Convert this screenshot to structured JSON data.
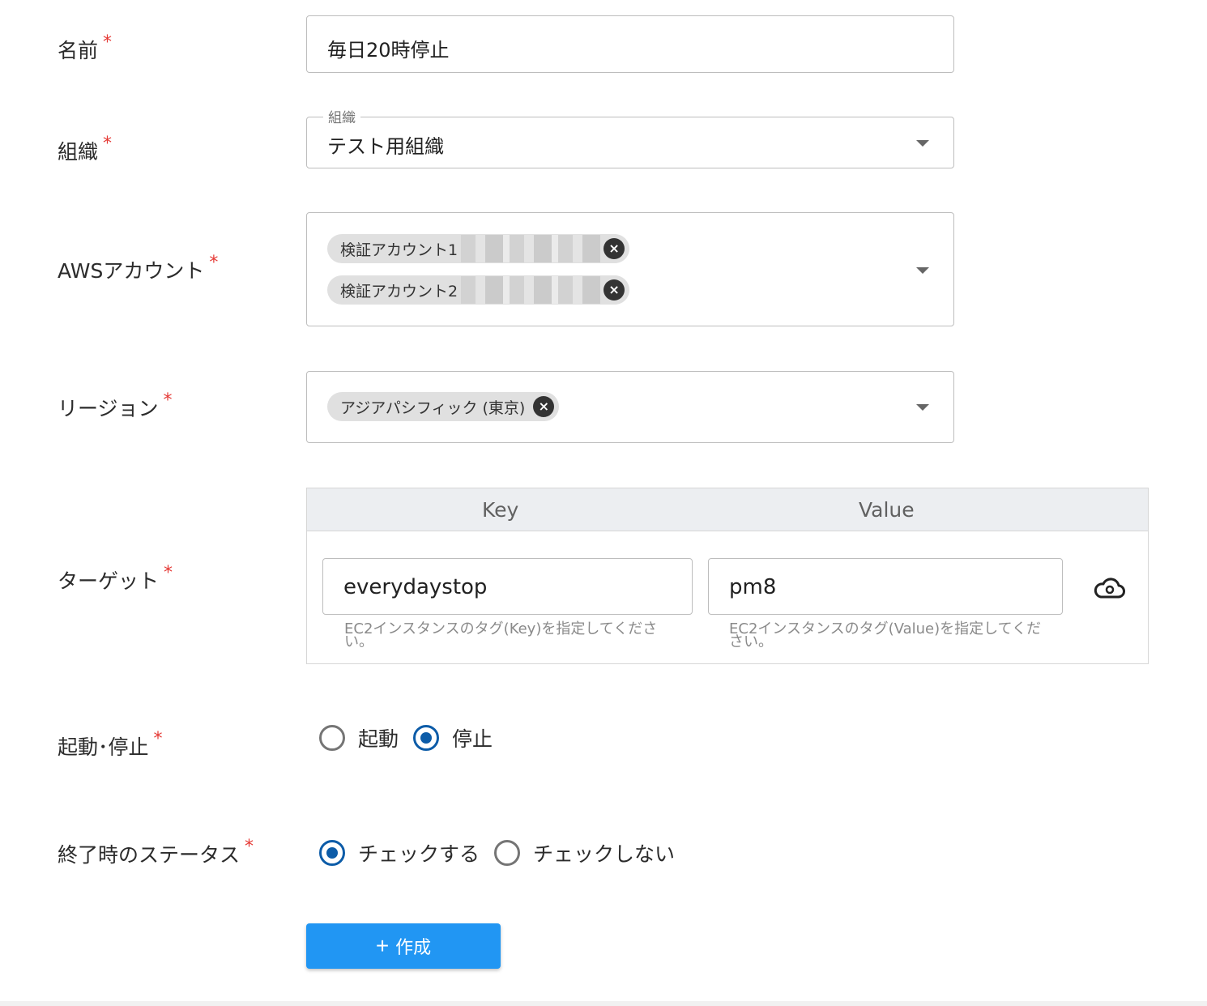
{
  "form": {
    "name": {
      "label": "名前",
      "required_mark": "*",
      "value": "毎日20時停止"
    },
    "organization": {
      "label": "組織",
      "required_mark": "*",
      "legend": "組織",
      "selected": "テスト用組織"
    },
    "aws_account": {
      "label": "AWSアカウント",
      "required_mark": "*",
      "chips": [
        {
          "label": "検証アカウント1"
        },
        {
          "label": "検証アカウント2"
        }
      ]
    },
    "region": {
      "label": "リージョン",
      "required_mark": "*",
      "chips": [
        {
          "label": "アジアパシフィック (東京)"
        }
      ]
    },
    "target": {
      "label": "ターゲット",
      "required_mark": "*",
      "key_header": "Key",
      "value_header": "Value",
      "key_value": "everydaystop",
      "value_value": "pm8",
      "key_hint": "EC2インスタンスのタグ(Key)を指定してください。",
      "value_hint": "EC2インスタンスのタグ(Value)を指定してください。"
    },
    "action": {
      "label": "起動･停止",
      "required_mark": "*",
      "options": [
        "起動",
        "停止"
      ],
      "selected": "停止"
    },
    "end_status": {
      "label": "終了時のステータス",
      "required_mark": "*",
      "options": [
        "チェックする",
        "チェックしない"
      ],
      "selected": "チェックする"
    },
    "create_button": {
      "icon": "plus-icon",
      "label": "作成"
    }
  },
  "colors": {
    "accent": "#2196f3",
    "radio_selected": "#0d5ca8",
    "required": "#e53935"
  }
}
